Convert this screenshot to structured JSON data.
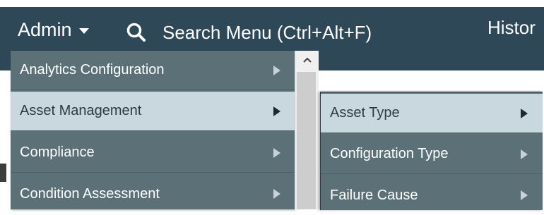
{
  "header": {
    "admin_label": "Admin",
    "search_placeholder": "Search Menu (Ctrl+Alt+F)",
    "history_label": "Histor"
  },
  "menu": {
    "items": [
      {
        "label": "Analytics Configuration"
      },
      {
        "label": "Asset Management"
      },
      {
        "label": "Compliance"
      },
      {
        "label": "Condition Assessment"
      }
    ],
    "active_index": 1
  },
  "submenu": {
    "items": [
      {
        "label": "Asset Type"
      },
      {
        "label": "Configuration Type"
      },
      {
        "label": "Failure Cause"
      }
    ],
    "active_index": 0
  },
  "colors": {
    "header_bg": "#2f4858",
    "menu_bg": "#5c7078",
    "highlight_bg": "#c9d7df"
  }
}
